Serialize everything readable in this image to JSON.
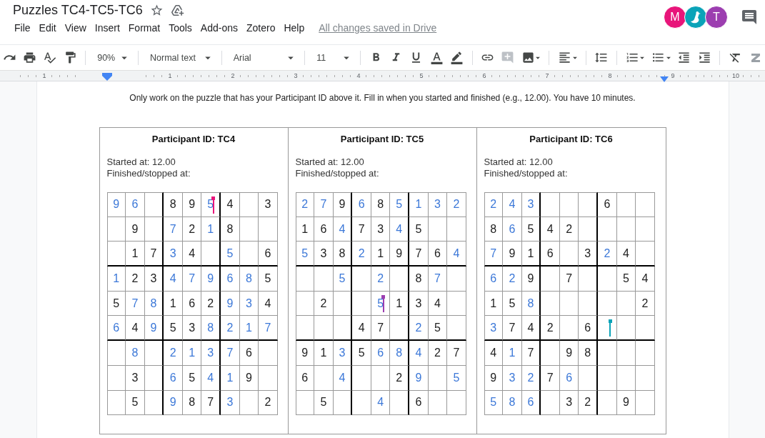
{
  "document": {
    "title": "Puzzles TC4-TC5-TC6",
    "save_status": "All changes saved in Drive"
  },
  "menu": [
    "File",
    "Edit",
    "View",
    "Insert",
    "Format",
    "Tools",
    "Add-ons",
    "Zotero",
    "Help"
  ],
  "collaborators": [
    {
      "kind": "letter",
      "letter": "M",
      "color": "#e8157a"
    },
    {
      "kind": "icon",
      "color": "#0aa3b8"
    },
    {
      "kind": "letter",
      "letter": "T",
      "color": "#9c3eb0"
    }
  ],
  "toolbar": {
    "zoom": "90%",
    "style": "Normal text",
    "font": "Arial",
    "size": "11"
  },
  "ruler": {
    "labels": [
      "1",
      "1",
      "2",
      "3",
      "4",
      "5",
      "6",
      "7",
      "8",
      "9",
      "10"
    ]
  },
  "instructions": "Only work on the puzzle that has your Participant ID above it. Fill in when you started and finished (e.g., 12.00). You have 10 minutes.",
  "puzzles": [
    {
      "title": "Participant ID: TC4",
      "started": "Started at: 12.00",
      "finished": "Finished/stopped at:",
      "grid": [
        [
          {
            "kind": "entered",
            "value": "9"
          },
          {
            "kind": "entered",
            "value": "6"
          },
          {
            "kind": "blank"
          },
          {
            "kind": "given",
            "value": "8"
          },
          {
            "kind": "given",
            "value": "9"
          },
          {
            "kind": "entered",
            "value": "5",
            "cursor": {
              "color": "#e8157a"
            }
          },
          {
            "kind": "given",
            "value": "4"
          },
          {
            "kind": "blank"
          },
          {
            "kind": "given",
            "value": "3"
          }
        ],
        [
          {
            "kind": "blank"
          },
          {
            "kind": "given",
            "value": "9"
          },
          {
            "kind": "blank"
          },
          {
            "kind": "entered",
            "value": "7"
          },
          {
            "kind": "given",
            "value": "2"
          },
          {
            "kind": "entered",
            "value": "1"
          },
          {
            "kind": "given",
            "value": "8"
          },
          {
            "kind": "blank"
          },
          {
            "kind": "blank"
          }
        ],
        [
          {
            "kind": "blank"
          },
          {
            "kind": "given",
            "value": "1"
          },
          {
            "kind": "given",
            "value": "7"
          },
          {
            "kind": "entered",
            "value": "3"
          },
          {
            "kind": "given",
            "value": "4"
          },
          {
            "kind": "blank"
          },
          {
            "kind": "entered",
            "value": "5"
          },
          {
            "kind": "blank"
          },
          {
            "kind": "given",
            "value": "6"
          }
        ],
        [
          {
            "kind": "entered",
            "value": "1"
          },
          {
            "kind": "given",
            "value": "2"
          },
          {
            "kind": "given",
            "value": "3"
          },
          {
            "kind": "entered",
            "value": "4"
          },
          {
            "kind": "entered",
            "value": "7"
          },
          {
            "kind": "entered",
            "value": "9"
          },
          {
            "kind": "entered",
            "value": "6"
          },
          {
            "kind": "entered",
            "value": "8"
          },
          {
            "kind": "given",
            "value": "5"
          }
        ],
        [
          {
            "kind": "given",
            "value": "5"
          },
          {
            "kind": "entered",
            "value": "7"
          },
          {
            "kind": "entered",
            "value": "8"
          },
          {
            "kind": "given",
            "value": "1"
          },
          {
            "kind": "given",
            "value": "6"
          },
          {
            "kind": "given",
            "value": "2"
          },
          {
            "kind": "entered",
            "value": "9"
          },
          {
            "kind": "entered",
            "value": "3"
          },
          {
            "kind": "given",
            "value": "4"
          }
        ],
        [
          {
            "kind": "entered",
            "value": "6"
          },
          {
            "kind": "given",
            "value": "4"
          },
          {
            "kind": "entered",
            "value": "9"
          },
          {
            "kind": "given",
            "value": "5"
          },
          {
            "kind": "given",
            "value": "3"
          },
          {
            "kind": "entered",
            "value": "8"
          },
          {
            "kind": "entered",
            "value": "2"
          },
          {
            "kind": "entered",
            "value": "1"
          },
          {
            "kind": "entered",
            "value": "7"
          }
        ],
        [
          {
            "kind": "blank"
          },
          {
            "kind": "entered",
            "value": "8"
          },
          {
            "kind": "blank"
          },
          {
            "kind": "entered",
            "value": "2"
          },
          {
            "kind": "entered",
            "value": "1"
          },
          {
            "kind": "entered",
            "value": "3"
          },
          {
            "kind": "entered",
            "value": "7"
          },
          {
            "kind": "given",
            "value": "6"
          },
          {
            "kind": "blank"
          }
        ],
        [
          {
            "kind": "blank"
          },
          {
            "kind": "given",
            "value": "3"
          },
          {
            "kind": "blank"
          },
          {
            "kind": "entered",
            "value": "6"
          },
          {
            "kind": "given",
            "value": "5"
          },
          {
            "kind": "entered",
            "value": "4"
          },
          {
            "kind": "entered",
            "value": "1"
          },
          {
            "kind": "given",
            "value": "9"
          },
          {
            "kind": "blank"
          }
        ],
        [
          {
            "kind": "blank"
          },
          {
            "kind": "given",
            "value": "5"
          },
          {
            "kind": "blank"
          },
          {
            "kind": "entered",
            "value": "9"
          },
          {
            "kind": "given",
            "value": "8"
          },
          {
            "kind": "given",
            "value": "7"
          },
          {
            "kind": "entered",
            "value": "3"
          },
          {
            "kind": "blank"
          },
          {
            "kind": "given",
            "value": "2"
          }
        ]
      ]
    },
    {
      "title": "Participant ID: TC5",
      "started": "Started at: 12.00",
      "finished": "Finished/stopped at:",
      "grid": [
        [
          {
            "kind": "entered",
            "value": "2"
          },
          {
            "kind": "entered",
            "value": "7"
          },
          {
            "kind": "given",
            "value": "9"
          },
          {
            "kind": "entered",
            "value": "6"
          },
          {
            "kind": "given",
            "value": "8"
          },
          {
            "kind": "entered",
            "value": "5"
          },
          {
            "kind": "entered",
            "value": "1"
          },
          {
            "kind": "entered",
            "value": "3"
          },
          {
            "kind": "entered",
            "value": "2"
          }
        ],
        [
          {
            "kind": "given",
            "value": "1"
          },
          {
            "kind": "given",
            "value": "6"
          },
          {
            "kind": "entered",
            "value": "4"
          },
          {
            "kind": "given",
            "value": "7"
          },
          {
            "kind": "given",
            "value": "3"
          },
          {
            "kind": "entered",
            "value": "4"
          },
          {
            "kind": "given",
            "value": "5"
          },
          {
            "kind": "blank"
          },
          {
            "kind": "blank"
          }
        ],
        [
          {
            "kind": "entered",
            "value": "5"
          },
          {
            "kind": "given",
            "value": "3"
          },
          {
            "kind": "given",
            "value": "8"
          },
          {
            "kind": "entered",
            "value": "2"
          },
          {
            "kind": "given",
            "value": "1"
          },
          {
            "kind": "given",
            "value": "9"
          },
          {
            "kind": "given",
            "value": "7"
          },
          {
            "kind": "given",
            "value": "6"
          },
          {
            "kind": "entered",
            "value": "4"
          }
        ],
        [
          {
            "kind": "blank"
          },
          {
            "kind": "blank"
          },
          {
            "kind": "entered",
            "value": "5"
          },
          {
            "kind": "blank"
          },
          {
            "kind": "entered",
            "value": "2"
          },
          {
            "kind": "blank"
          },
          {
            "kind": "given",
            "value": "8"
          },
          {
            "kind": "entered",
            "value": "7"
          },
          {
            "kind": "blank"
          }
        ],
        [
          {
            "kind": "blank"
          },
          {
            "kind": "given",
            "value": "2"
          },
          {
            "kind": "blank"
          },
          {
            "kind": "blank"
          },
          {
            "kind": "entered",
            "value": "5",
            "cursor": {
              "color": "#9c3eb0"
            }
          },
          {
            "kind": "given",
            "value": "1"
          },
          {
            "kind": "given",
            "value": "3"
          },
          {
            "kind": "given",
            "value": "4"
          },
          {
            "kind": "blank"
          }
        ],
        [
          {
            "kind": "blank"
          },
          {
            "kind": "blank"
          },
          {
            "kind": "blank"
          },
          {
            "kind": "given",
            "value": "4"
          },
          {
            "kind": "given",
            "value": "7"
          },
          {
            "kind": "blank"
          },
          {
            "kind": "entered",
            "value": "2"
          },
          {
            "kind": "given",
            "value": "5"
          },
          {
            "kind": "blank"
          }
        ],
        [
          {
            "kind": "given",
            "value": "9"
          },
          {
            "kind": "given",
            "value": "1"
          },
          {
            "kind": "entered",
            "value": "3"
          },
          {
            "kind": "given",
            "value": "5"
          },
          {
            "kind": "entered",
            "value": "6"
          },
          {
            "kind": "entered",
            "value": "8"
          },
          {
            "kind": "entered",
            "value": "4"
          },
          {
            "kind": "given",
            "value": "2"
          },
          {
            "kind": "given",
            "value": "7"
          }
        ],
        [
          {
            "kind": "given",
            "value": "6"
          },
          {
            "kind": "blank"
          },
          {
            "kind": "entered",
            "value": "4"
          },
          {
            "kind": "blank"
          },
          {
            "kind": "blank"
          },
          {
            "kind": "given",
            "value": "2"
          },
          {
            "kind": "entered",
            "value": "9"
          },
          {
            "kind": "blank"
          },
          {
            "kind": "entered",
            "value": "5"
          }
        ],
        [
          {
            "kind": "blank"
          },
          {
            "kind": "given",
            "value": "5"
          },
          {
            "kind": "blank"
          },
          {
            "kind": "blank"
          },
          {
            "kind": "entered",
            "value": "4"
          },
          {
            "kind": "blank"
          },
          {
            "kind": "given",
            "value": "6"
          },
          {
            "kind": "blank"
          },
          {
            "kind": "blank"
          }
        ]
      ]
    },
    {
      "title": "Participant ID: TC6",
      "started": "Started at: 12.00",
      "finished": "Finished/stopped at:",
      "grid": [
        [
          {
            "kind": "entered",
            "value": "2"
          },
          {
            "kind": "entered",
            "value": "4"
          },
          {
            "kind": "entered",
            "value": "3"
          },
          {
            "kind": "blank"
          },
          {
            "kind": "blank"
          },
          {
            "kind": "blank"
          },
          {
            "kind": "given",
            "value": "6"
          },
          {
            "kind": "blank"
          },
          {
            "kind": "blank"
          }
        ],
        [
          {
            "kind": "given",
            "value": "8"
          },
          {
            "kind": "entered",
            "value": "6"
          },
          {
            "kind": "given",
            "value": "5"
          },
          {
            "kind": "given",
            "value": "4"
          },
          {
            "kind": "given",
            "value": "2"
          },
          {
            "kind": "blank"
          },
          {
            "kind": "blank"
          },
          {
            "kind": "blank"
          },
          {
            "kind": "blank"
          }
        ],
        [
          {
            "kind": "entered",
            "value": "7"
          },
          {
            "kind": "given",
            "value": "9"
          },
          {
            "kind": "given",
            "value": "1"
          },
          {
            "kind": "given",
            "value": "6"
          },
          {
            "kind": "blank"
          },
          {
            "kind": "given",
            "value": "3"
          },
          {
            "kind": "entered",
            "value": "2"
          },
          {
            "kind": "given",
            "value": "4"
          },
          {
            "kind": "blank"
          }
        ],
        [
          {
            "kind": "entered",
            "value": "6"
          },
          {
            "kind": "entered",
            "value": "2"
          },
          {
            "kind": "given",
            "value": "9"
          },
          {
            "kind": "blank"
          },
          {
            "kind": "given",
            "value": "7"
          },
          {
            "kind": "blank"
          },
          {
            "kind": "blank"
          },
          {
            "kind": "given",
            "value": "5"
          },
          {
            "kind": "given",
            "value": "4"
          }
        ],
        [
          {
            "kind": "given",
            "value": "1"
          },
          {
            "kind": "given",
            "value": "5"
          },
          {
            "kind": "entered",
            "value": "8"
          },
          {
            "kind": "blank"
          },
          {
            "kind": "blank"
          },
          {
            "kind": "blank"
          },
          {
            "kind": "blank"
          },
          {
            "kind": "blank"
          },
          {
            "kind": "given",
            "value": "2"
          }
        ],
        [
          {
            "kind": "entered",
            "value": "3"
          },
          {
            "kind": "given",
            "value": "7"
          },
          {
            "kind": "given",
            "value": "4"
          },
          {
            "kind": "given",
            "value": "2"
          },
          {
            "kind": "blank"
          },
          {
            "kind": "given",
            "value": "6"
          },
          {
            "kind": "blank",
            "cursor": {
              "color": "#0aa3b8"
            }
          },
          {
            "kind": "blank"
          },
          {
            "kind": "blank"
          }
        ],
        [
          {
            "kind": "given",
            "value": "4"
          },
          {
            "kind": "entered",
            "value": "1"
          },
          {
            "kind": "given",
            "value": "7"
          },
          {
            "kind": "blank"
          },
          {
            "kind": "given",
            "value": "9"
          },
          {
            "kind": "given",
            "value": "8"
          },
          {
            "kind": "blank"
          },
          {
            "kind": "blank"
          },
          {
            "kind": "blank"
          }
        ],
        [
          {
            "kind": "given",
            "value": "9"
          },
          {
            "kind": "entered",
            "value": "3"
          },
          {
            "kind": "entered",
            "value": "2"
          },
          {
            "kind": "given",
            "value": "7"
          },
          {
            "kind": "entered",
            "value": "6"
          },
          {
            "kind": "blank"
          },
          {
            "kind": "blank"
          },
          {
            "kind": "blank"
          },
          {
            "kind": "blank"
          }
        ],
        [
          {
            "kind": "entered",
            "value": "5"
          },
          {
            "kind": "entered",
            "value": "8"
          },
          {
            "kind": "entered",
            "value": "6"
          },
          {
            "kind": "blank"
          },
          {
            "kind": "given",
            "value": "3"
          },
          {
            "kind": "given",
            "value": "2"
          },
          {
            "kind": "blank"
          },
          {
            "kind": "given",
            "value": "9"
          },
          {
            "kind": "blank"
          }
        ]
      ]
    }
  ]
}
